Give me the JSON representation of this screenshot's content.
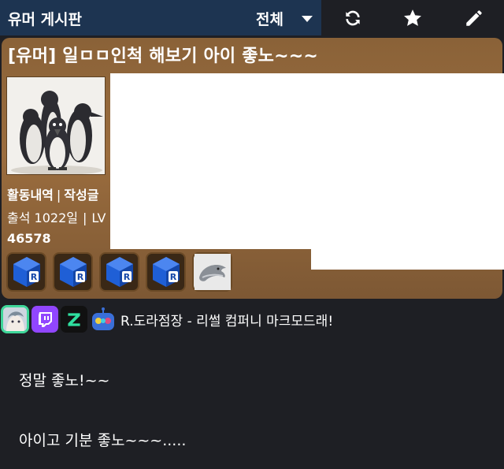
{
  "topbar": {
    "board_title": "유머 게시판",
    "filter_label": "전체",
    "icons": [
      "refresh-icon",
      "star-icon",
      "pencil-icon"
    ]
  },
  "post": {
    "title": "[유머] 일ㅁㅁ인척 해보기 아이 좋노~~~",
    "profile": {
      "activity_label": "활동내역",
      "posts_label": "작성글",
      "attendance": "출석 1022일",
      "level_prefix": "LV",
      "points": "46578",
      "badges": [
        "r-cube-badge",
        "r-cube-badge",
        "r-cube-badge",
        "r-cube-badge",
        "dolphin-badge"
      ]
    },
    "author": {
      "name": "R.도라점장 - 리썰 컴퍼니 마크모드래!"
    },
    "content": {
      "line1": "정말 좋노!~~",
      "line2": "아이고 기분 좋노~~~....."
    }
  },
  "colors": {
    "board_bar": "#1d3451",
    "panel": "#8a6238",
    "background": "#1e1f24",
    "twitch": "#9146ff",
    "avatar_border": "#3fd79a"
  }
}
